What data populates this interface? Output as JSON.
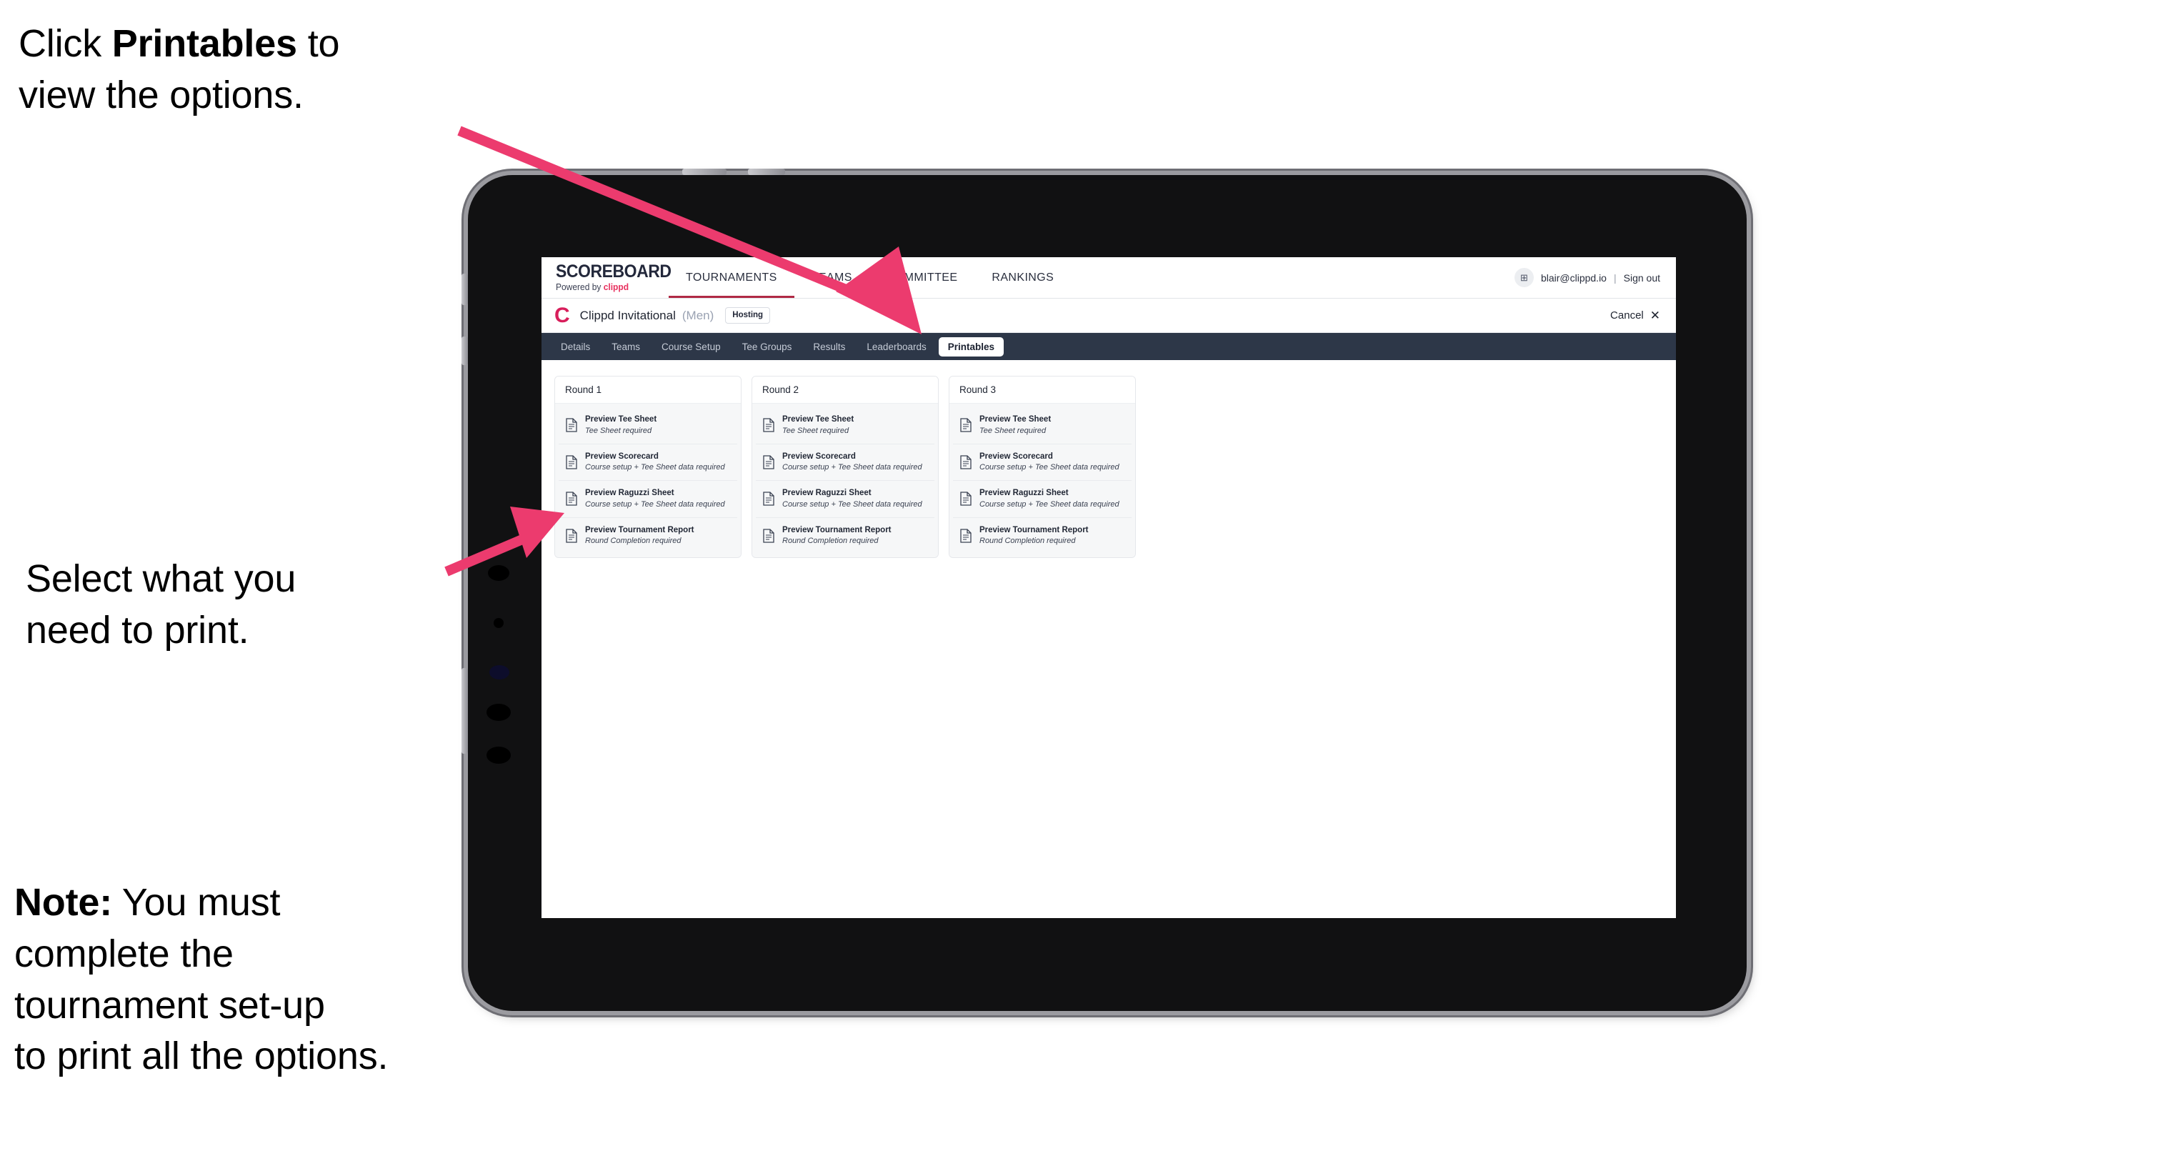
{
  "annotations": {
    "click_printables": {
      "prefix": "Click ",
      "bold": "Printables",
      "suffix": " to\nview the options."
    },
    "select_print": "Select what you\n need to print.",
    "note": {
      "bold": "Note:",
      "rest": " You must\ncomplete the\ntournament set-up\nto print all the options."
    },
    "arrow_color": "#ec3b6e"
  },
  "browser": {
    "brand": {
      "name": "SCOREBOARD",
      "powered_prefix": "Powered by ",
      "powered_brand": "clippd"
    },
    "main_nav": [
      {
        "label": "TOURNAMENTS",
        "active": true
      },
      {
        "label": "TEAMS",
        "active": false
      },
      {
        "label": "COMMITTEE",
        "active": false
      },
      {
        "label": "RANKINGS",
        "active": false
      }
    ],
    "account": {
      "avatar_glyph": "⊞",
      "email": "blair@clippd.io",
      "separator": "|",
      "sign_out": "Sign out"
    },
    "tournament": {
      "logo_letter": "C",
      "name": "Clippd Invitational",
      "gender": "(Men)",
      "status_badge": "Hosting",
      "cancel_label": "Cancel",
      "cancel_icon": "✕"
    },
    "sub_nav": [
      {
        "label": "Details",
        "active": false
      },
      {
        "label": "Teams",
        "active": false
      },
      {
        "label": "Course Setup",
        "active": false
      },
      {
        "label": "Tee Groups",
        "active": false
      },
      {
        "label": "Results",
        "active": false
      },
      {
        "label": "Leaderboards",
        "active": false
      },
      {
        "label": "Printables",
        "active": true
      }
    ],
    "rounds": [
      {
        "title": "Round 1",
        "documents": [
          {
            "title": "Preview Tee Sheet",
            "requirement": "Tee Sheet required",
            "icon": "document-icon"
          },
          {
            "title": "Preview Scorecard",
            "requirement": "Course setup + Tee Sheet data required",
            "icon": "document-icon"
          },
          {
            "title": "Preview Raguzzi Sheet",
            "requirement": "Course setup + Tee Sheet data required",
            "icon": "document-icon"
          },
          {
            "title": "Preview Tournament Report",
            "requirement": "Round Completion required",
            "icon": "document-icon"
          }
        ]
      },
      {
        "title": "Round 2",
        "documents": [
          {
            "title": "Preview Tee Sheet",
            "requirement": "Tee Sheet required",
            "icon": "document-icon"
          },
          {
            "title": "Preview Scorecard",
            "requirement": "Course setup + Tee Sheet data required",
            "icon": "document-icon"
          },
          {
            "title": "Preview Raguzzi Sheet",
            "requirement": "Course setup + Tee Sheet data required",
            "icon": "document-icon"
          },
          {
            "title": "Preview Tournament Report",
            "requirement": "Round Completion required",
            "icon": "document-icon"
          }
        ]
      },
      {
        "title": "Round 3",
        "documents": [
          {
            "title": "Preview Tee Sheet",
            "requirement": "Tee Sheet required",
            "icon": "document-icon"
          },
          {
            "title": "Preview Scorecard",
            "requirement": "Course setup + Tee Sheet data required",
            "icon": "document-icon"
          },
          {
            "title": "Preview Raguzzi Sheet",
            "requirement": "Course setup + Tee Sheet data required",
            "icon": "document-icon"
          },
          {
            "title": "Preview Tournament Report",
            "requirement": "Round Completion required",
            "icon": "document-icon"
          }
        ]
      }
    ]
  },
  "colors": {
    "accent_pink": "#ec3b6e",
    "brand_red": "#d81e5b",
    "subnav_navy": "#2d3748",
    "active_underline": "#b02a45"
  }
}
